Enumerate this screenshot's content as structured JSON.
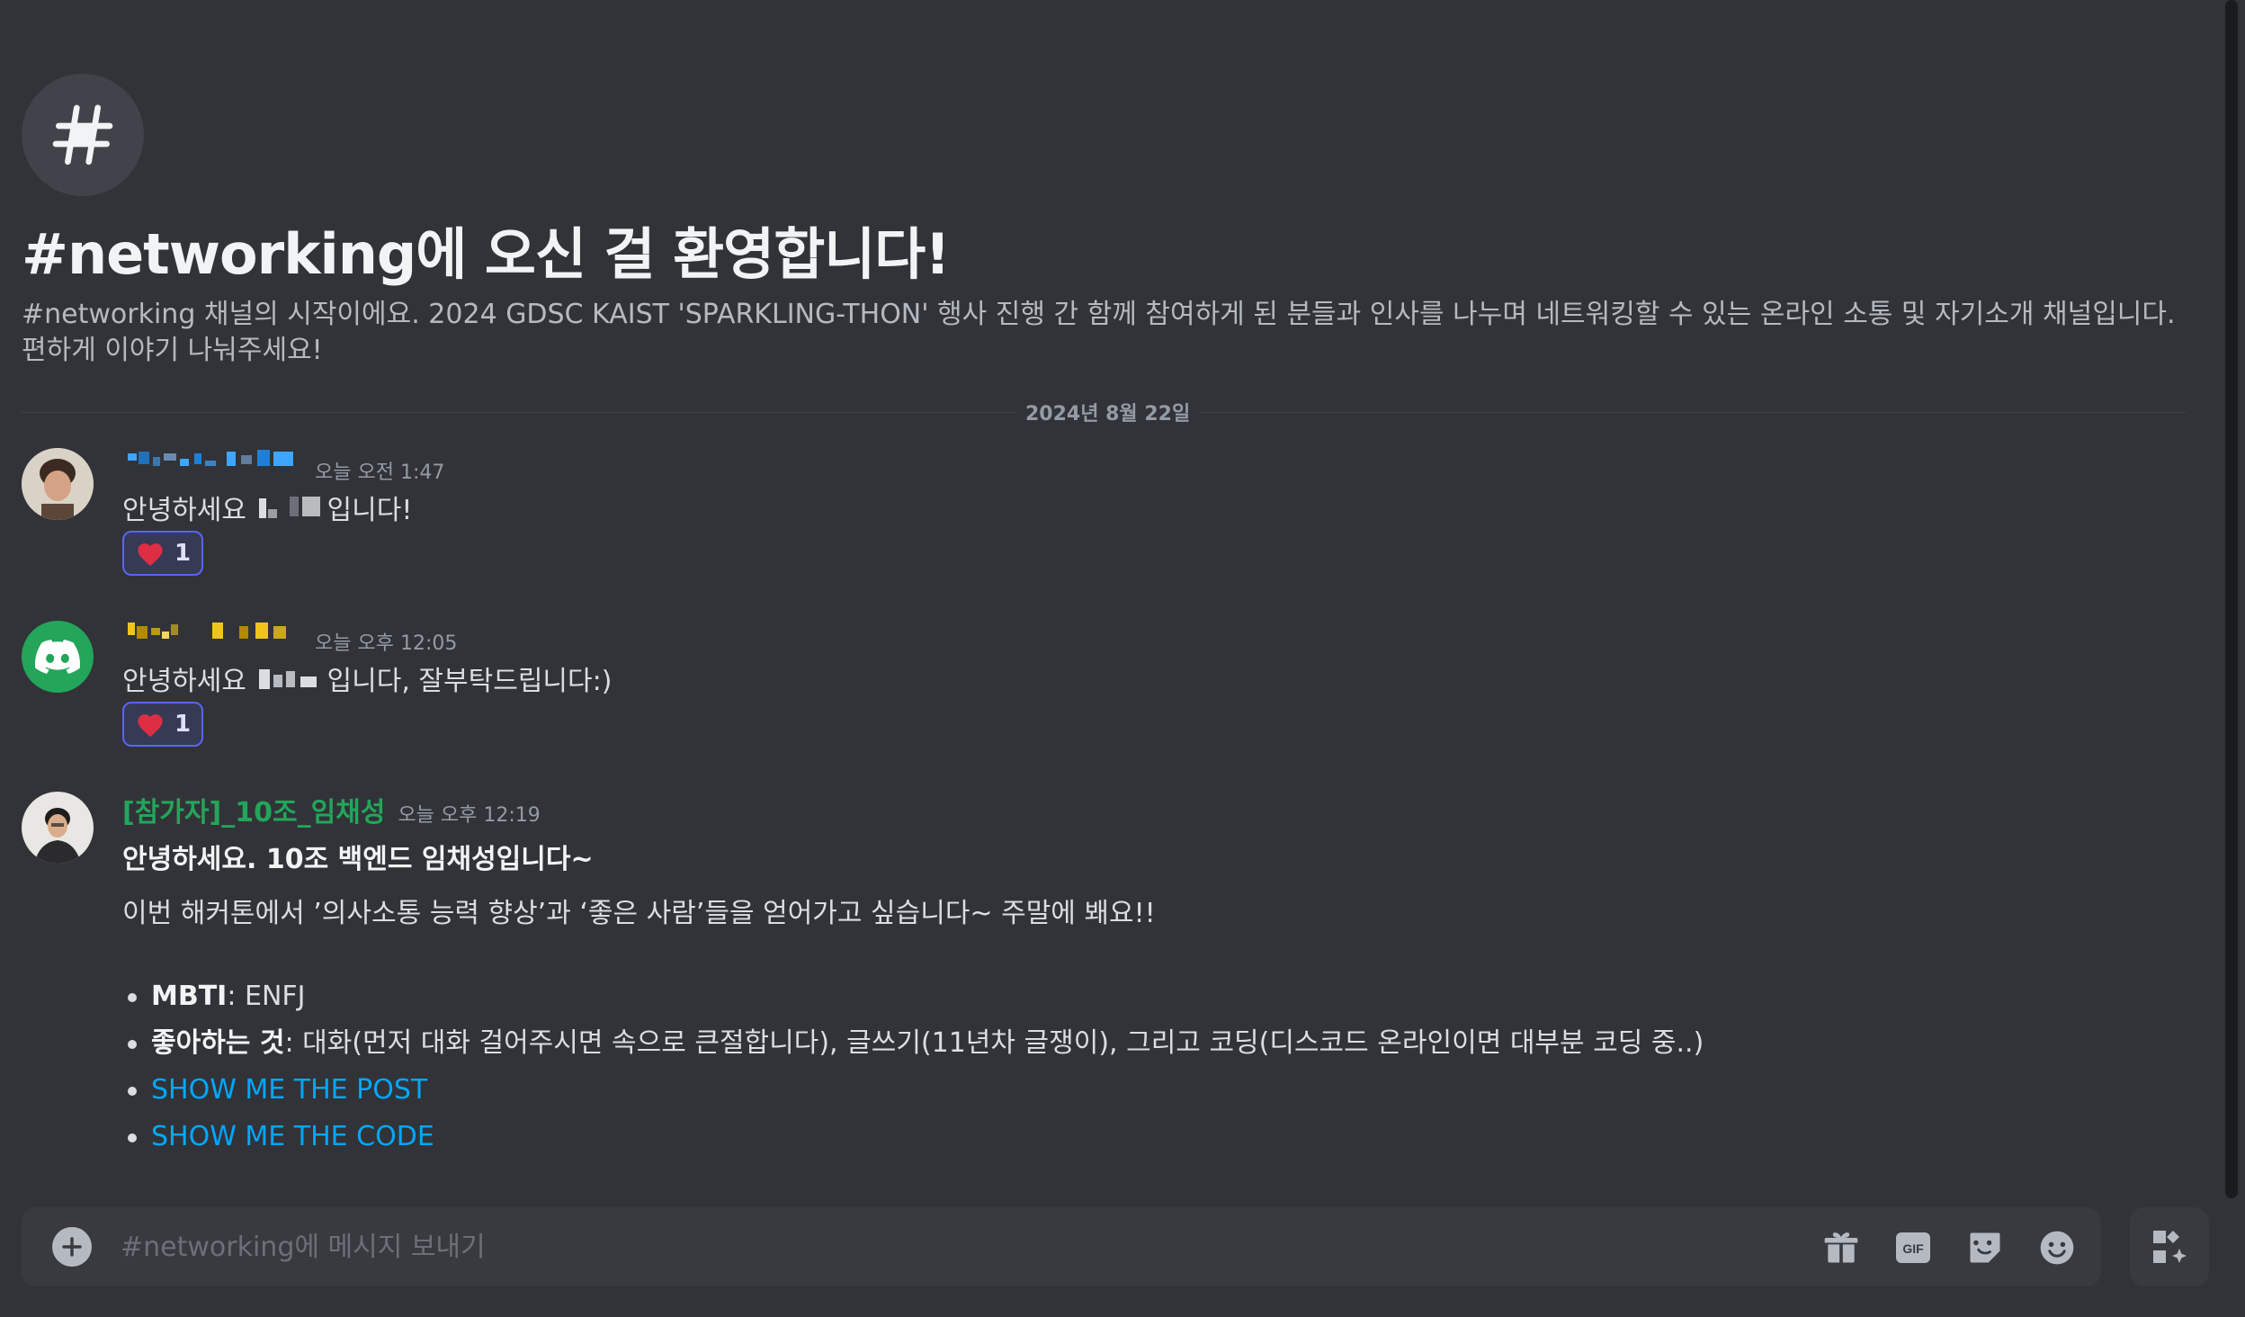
{
  "channel": {
    "welcome_title": "#networking에 오신 걸 환영합니다!",
    "welcome_description": "#networking 채널의 시작이에요. 2024 GDSC KAIST 'SPARKLING-THON' 행사 진행 간 함께 참여하게 된 분들과 인사를 나누며 네트워킹할 수 있는 온라인 소통 및 자기소개 채널입니다. 편하게 이야기 나눠주세요!",
    "date_divider": "2024년 8월 22일"
  },
  "messages": [
    {
      "timestamp": "오늘 오전 1:47",
      "text_before": "안녕하세요 ",
      "text_after": "입니다!",
      "reaction_emoji": "heart",
      "reaction_count": "1",
      "username_color": "#3ea6ff"
    },
    {
      "timestamp": "오늘 오후 12:05",
      "text_before": "안녕하세요 ",
      "text_after": "입니다, 잘부탁드립니다:)",
      "reaction_emoji": "heart",
      "reaction_count": "1",
      "username_color": "#f0c419"
    },
    {
      "username": "[참가자]_10조_임채성",
      "timestamp": "오늘 오후 12:19",
      "headline": "안녕하세요. 10조 백엔드 임채성입니다~",
      "body": "이번 해커톤에서 ’의사소통 능력 향상’과 ‘좋은 사람’들을 얻어가고 싶습니다~ 주말에 봬요!!",
      "username_color": "#23a55a",
      "bullets": [
        {
          "label": "MBTI",
          "value": ": ENFJ"
        },
        {
          "label": "좋아하는 것",
          "value": ": 대화(먼저 대화 걸어주시면 속으로 큰절합니다), 글쓰기(11년차 글쟁이), 그리고 코딩(디스코드 온라인이면 대부분 코딩 중..)"
        }
      ],
      "links": [
        "SHOW ME THE POST",
        "SHOW ME THE CODE"
      ]
    }
  ],
  "composer": {
    "placeholder": "#networking에 메시지 보내기",
    "buttons": [
      "gift-icon",
      "gif-icon",
      "sticker-icon",
      "emoji-icon"
    ],
    "gif_label": "GIF"
  },
  "colors": {
    "background": "#313338",
    "accent": "#5865f2",
    "link": "#00a8fc",
    "discord_green": "#23a55a"
  }
}
